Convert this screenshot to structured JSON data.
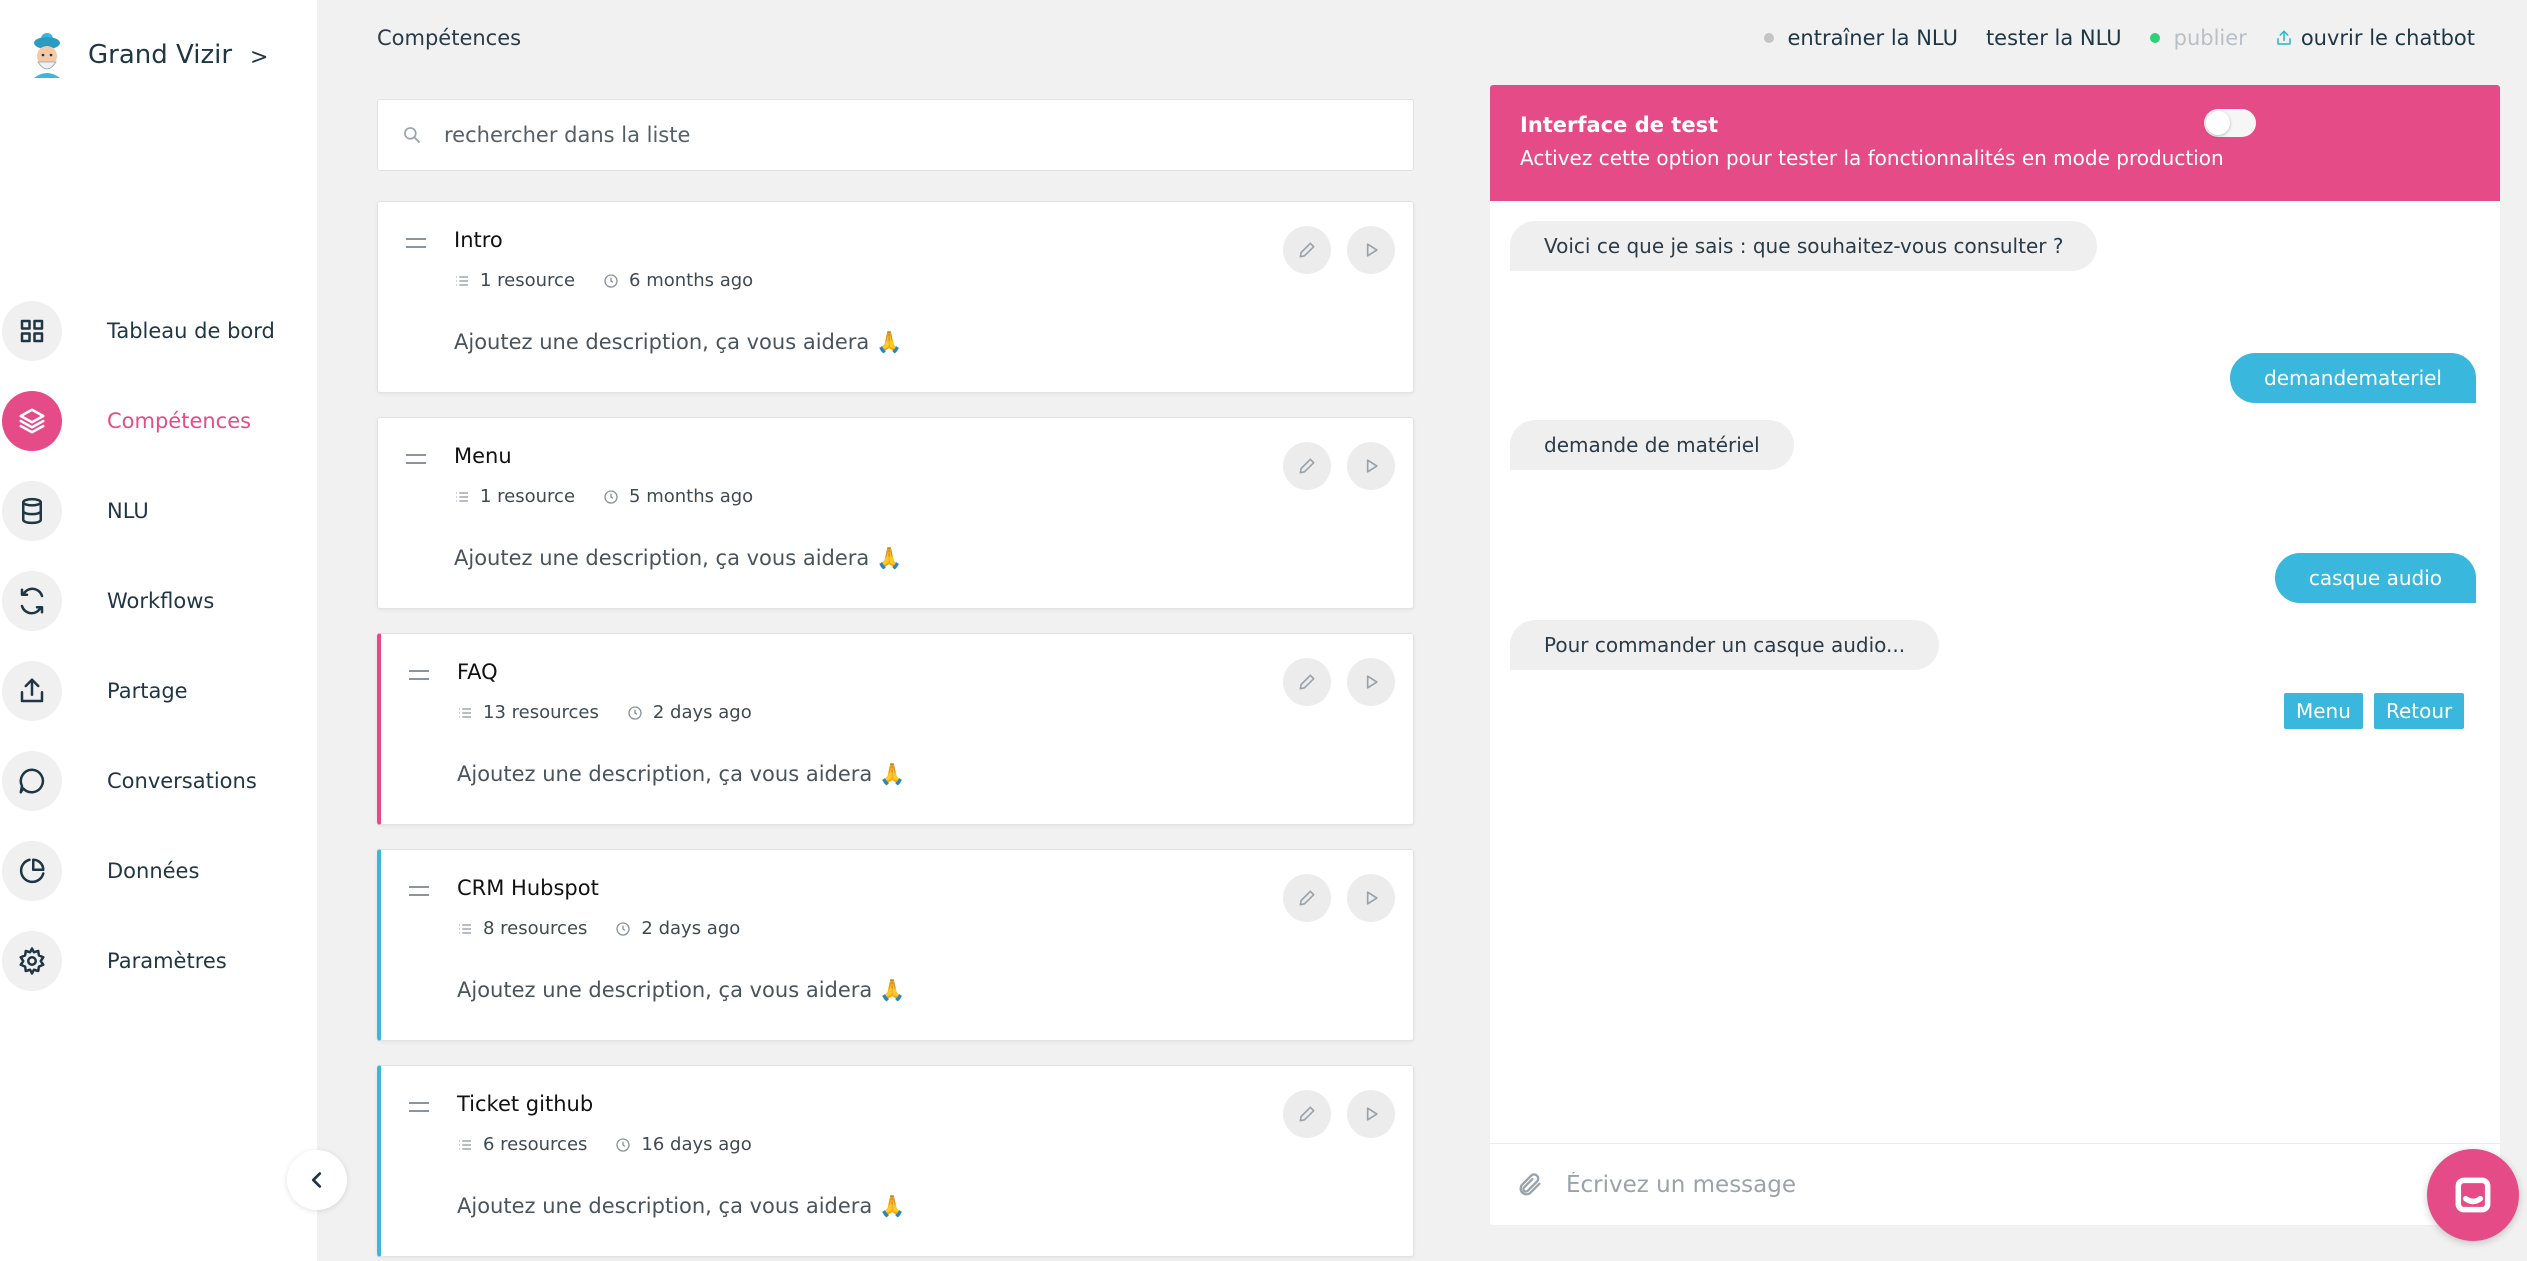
{
  "sidebar": {
    "brand": "Grand Vizir",
    "brand_chevron": ">",
    "items": [
      {
        "label": "Tableau de bord",
        "icon": "grid-icon"
      },
      {
        "label": "Compétences",
        "icon": "layers-icon"
      },
      {
        "label": "NLU",
        "icon": "database-icon"
      },
      {
        "label": "Workflows",
        "icon": "refresh-icon"
      },
      {
        "label": "Partage",
        "icon": "share-icon"
      },
      {
        "label": "Conversations",
        "icon": "chat-icon"
      },
      {
        "label": "Données",
        "icon": "pie-chart-icon"
      },
      {
        "label": "Paramètres",
        "icon": "gear-icon"
      }
    ],
    "active_item": "Compétences"
  },
  "header": {
    "page_title": "Compétences",
    "train": "entraîner la NLU",
    "test": "tester la NLU",
    "publish": "publier",
    "open_chatbot": "ouvrir le chatbot"
  },
  "search": {
    "placeholder": "rechercher dans la liste"
  },
  "skills": [
    {
      "title": "Intro",
      "resources": "1 resource",
      "updated": "6 months ago",
      "description": "Ajoutez une description, ça vous aidera 🙏"
    },
    {
      "title": "Menu",
      "resources": "1 resource",
      "updated": "5 months ago",
      "description": "Ajoutez une description, ça vous aidera 🙏"
    },
    {
      "title": "FAQ",
      "resources": "13 resources",
      "updated": "2 days ago",
      "description": "Ajoutez une description, ça vous aidera 🙏"
    },
    {
      "title": "CRM Hubspot",
      "resources": "8 resources",
      "updated": "2 days ago",
      "description": "Ajoutez une description, ça vous aidera 🙏"
    },
    {
      "title": "Ticket github",
      "resources": "6 resources",
      "updated": "16 days ago",
      "description": "Ajoutez une description, ça vous aidera 🙏"
    }
  ],
  "test_panel": {
    "title": "Interface de test",
    "subtitle": "Activez cette option pour tester la fonctionnalités en mode production",
    "toggle_on": false,
    "messages": [
      {
        "from": "bot",
        "text": "Voici ce que je sais : que souhaitez-vous consulter ?"
      },
      {
        "from": "user",
        "text": "demandemateriel"
      },
      {
        "from": "bot",
        "text": "demande de matériel"
      },
      {
        "from": "user",
        "text": "casque audio"
      },
      {
        "from": "bot",
        "text": "Pour commander un casque audio..."
      }
    ],
    "quick_replies": [
      "Menu",
      "Retour"
    ],
    "composer_placeholder": "Écrivez un message"
  },
  "colors": {
    "accent": "#e54c87",
    "secondary": "#3ab7dc",
    "status_gray": "#c4c4c4",
    "status_green": "#2fd07a"
  }
}
